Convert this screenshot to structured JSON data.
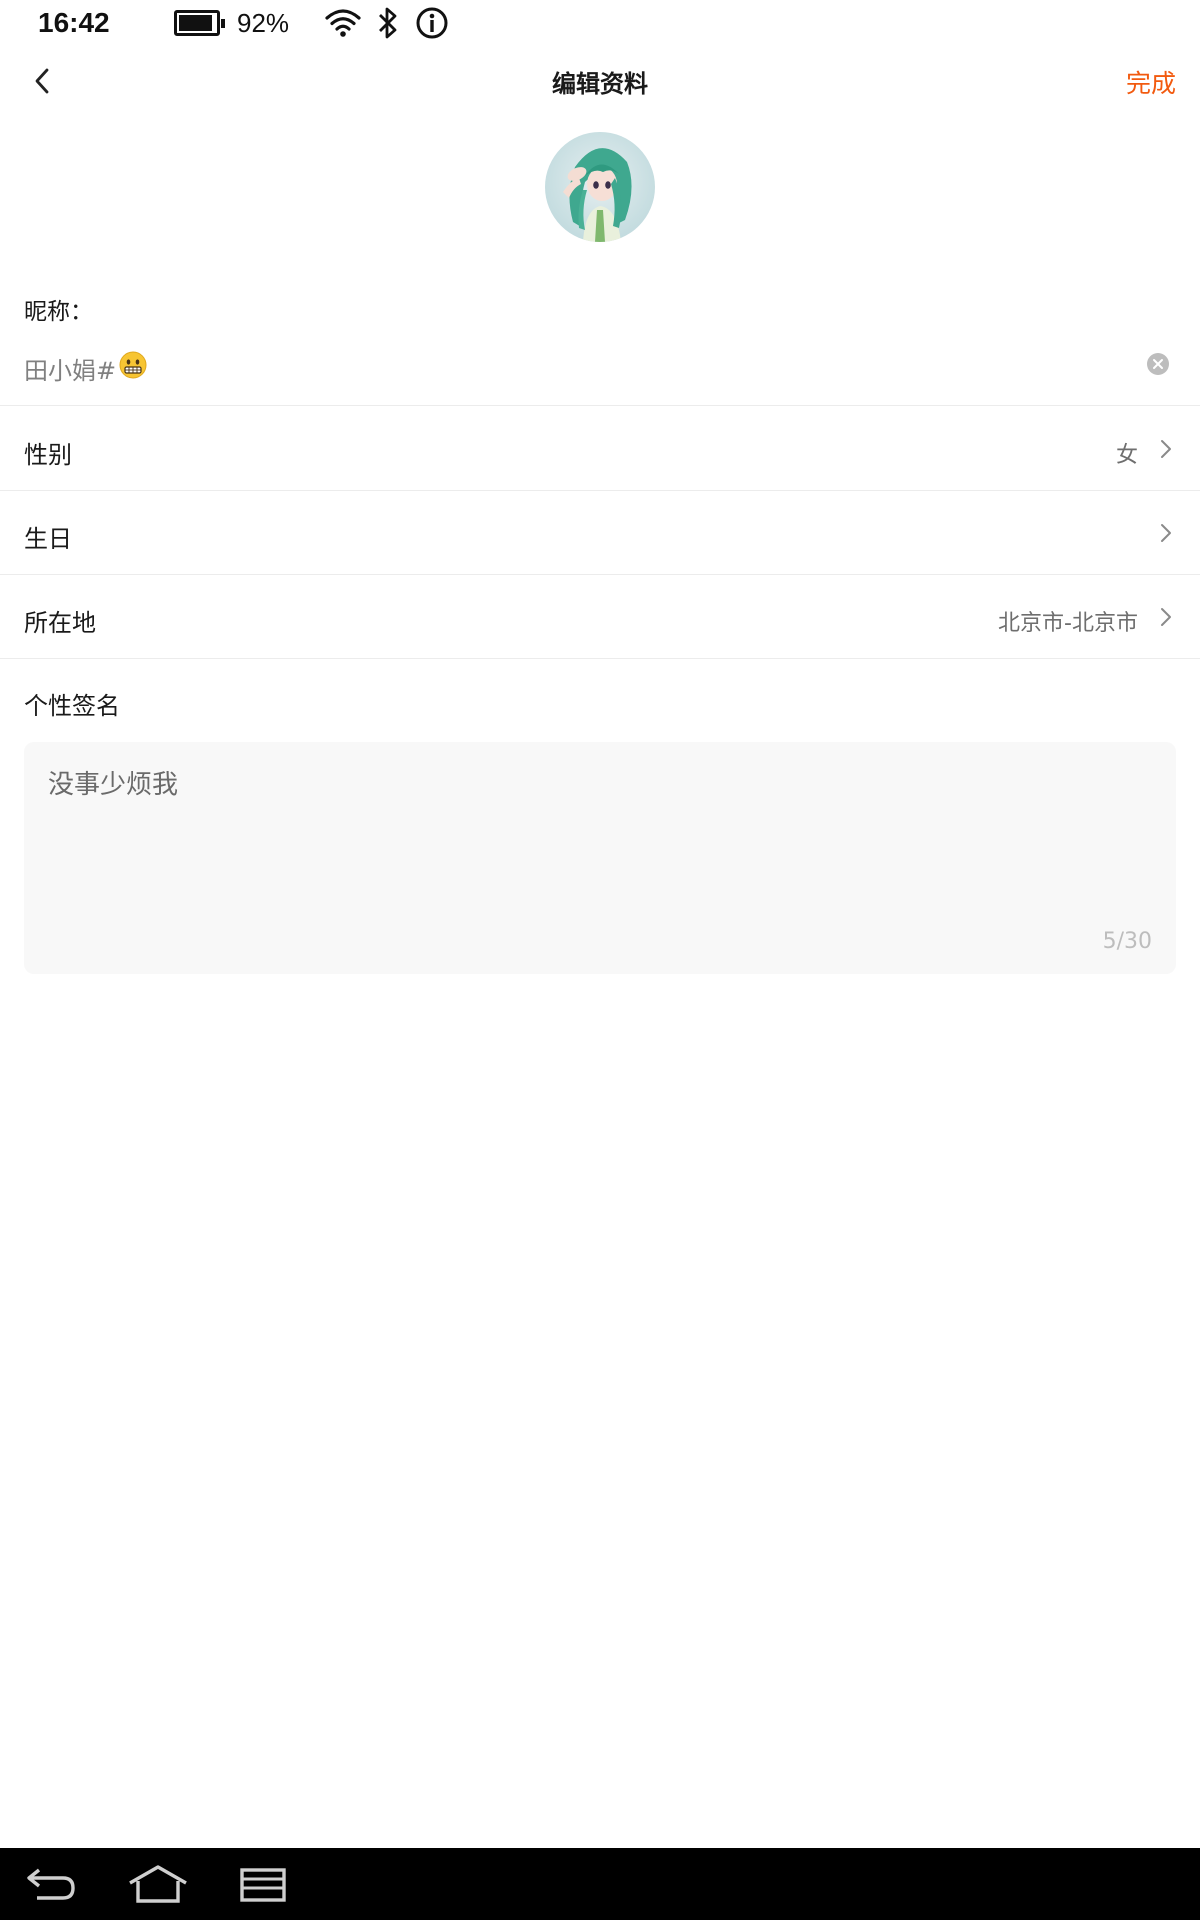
{
  "status_bar": {
    "time": "16:42",
    "battery_percent": "92%",
    "battery_level": 0.92,
    "icons": [
      "battery-icon",
      "wifi-icon",
      "bluetooth-icon",
      "info-icon"
    ]
  },
  "header": {
    "title": "编辑资料",
    "done_label": "完成",
    "accent_color": "#f25a0f"
  },
  "profile": {
    "nickname_label": "昵称：",
    "nickname_value": "田小娟#",
    "nickname_emoji": "neutral-face-emoji"
  },
  "fields": [
    {
      "label": "性别",
      "value": "女"
    },
    {
      "label": "生日",
      "value": ""
    },
    {
      "label": "所在地",
      "value": "北京市-北京市"
    }
  ],
  "signature": {
    "label": "个性签名",
    "text": "没事少烦我",
    "counter": "5/30"
  },
  "nav_bar": {
    "icons": [
      "back-nav-icon",
      "home-nav-icon",
      "recents-nav-icon"
    ]
  }
}
